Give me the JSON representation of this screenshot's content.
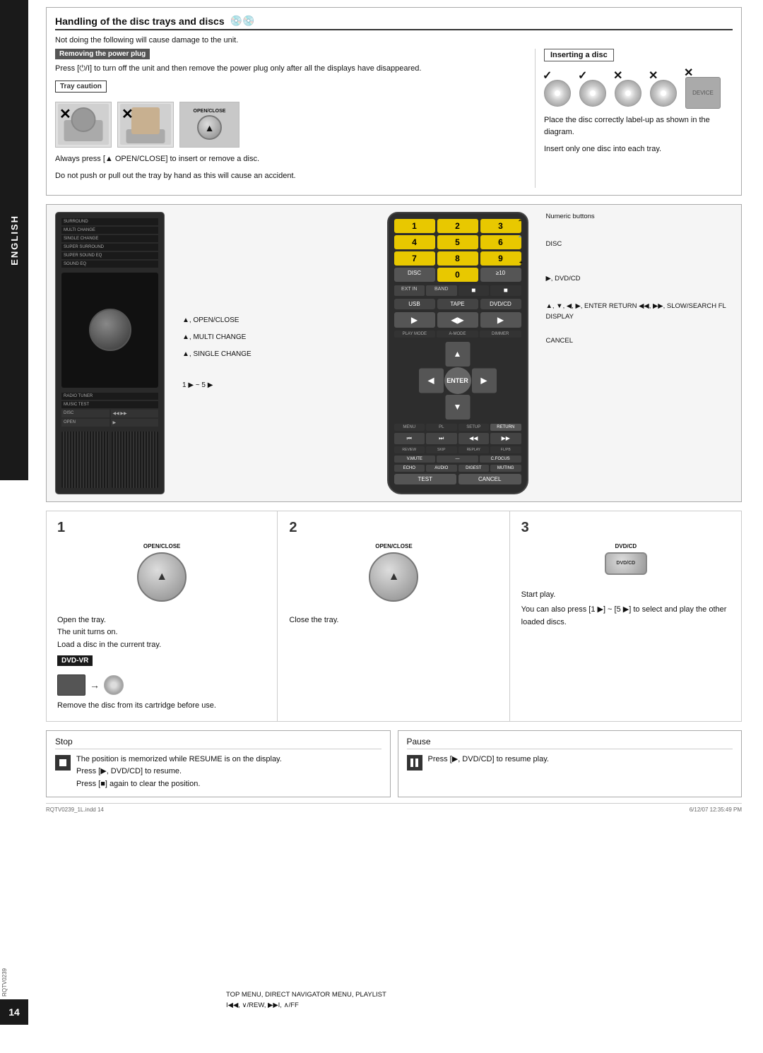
{
  "page": {
    "number": "14",
    "language_sidebar": "ENGLISH",
    "doc_id": "RQTV0239"
  },
  "handling_section": {
    "title": "Handling of the disc trays and discs",
    "warning_text": "Not doing the following will cause damage to the unit.",
    "removing_plug_label": "Removing the power plug",
    "press_text": "Press [⏻/I] to turn off the unit and then remove the power plug only after all the displays have disappeared.",
    "tray_caution_label": "Tray caution",
    "open_close_label": "OPEN/CLOSE",
    "always_press_text": "Always press [▲ OPEN/CLOSE] to insert or remove a disc.",
    "not_push_text": "Do not push or pull out the tray by hand as this will cause an accident.",
    "inserting_label": "Inserting a disc",
    "place_disc_text": "Place the disc correctly label-up as shown in the diagram.",
    "insert_one_text": "Insert only one disc into each tray."
  },
  "remote_section": {
    "stereo_labels": [
      "SURROUND",
      "MULTI CHANGE",
      "SINGLE CHANGE",
      "SUPER SURROUND",
      "SUPER SOUND EQ",
      "SOUND EQ",
      "RADIO TUNER",
      "MUSIC TEST",
      "DISC ▸",
      "OPEN ▸"
    ],
    "control_labels": [
      "▲, OPEN/CLOSE",
      "▲, MULTI CHANGE",
      "▲, SINGLE CHANGE",
      "1 ▶  ~  5 ▶"
    ],
    "numeric_label": "Numeric\nbuttons",
    "disc_label": "DISC",
    "dvd_cd_label": "▶, DVD/CD",
    "top_menu_labels": "TOP MENU,\nDIRECT NAVIGATOR\nMENU, PLAYLIST",
    "rew_ff_labels": "I◀◀, ∨/REW,\n▶▶I, ∧/FF",
    "nav_labels": "▲, ▼, ◀, ▶,\nENTER\nRETURN\n◀◀, ▶▶,\nSLOW/SEARCH\nFL DISPLAY",
    "cancel_label": "CANCEL",
    "remote_buttons": {
      "row1": [
        "1",
        "2",
        "3"
      ],
      "row2": [
        "4",
        "5",
        "6"
      ],
      "row3": [
        "7",
        "8",
        "9"
      ],
      "row4": [
        "DISC",
        "0",
        "≥10"
      ],
      "row5": [
        "USB",
        "TAPE",
        "DVD/CD"
      ]
    }
  },
  "steps": [
    {
      "number": "1",
      "button_label": "OPEN/CLOSE",
      "text1": "Open the tray.",
      "text2": "The unit turns on.",
      "text3": "Load a disc in the current tray.",
      "dvd_vr_label": "DVD-VR",
      "dvd_vr_text": "Remove the disc from its cartridge before use."
    },
    {
      "number": "2",
      "button_label": "OPEN/CLOSE",
      "text1": "Close the tray."
    },
    {
      "number": "3",
      "button_label": "DVD/CD",
      "text1": "Start play.",
      "text2": "You can also press [1 ▶] ~ [5 ▶] to select and play the other loaded discs."
    }
  ],
  "stop_section": {
    "title": "Stop",
    "text1": "The position is memorized while  RESUME  is on the display.",
    "text2": "Press [▶, DVD/CD] to resume.",
    "text3": "Press [■] again to clear the position."
  },
  "pause_section": {
    "title": "Pause",
    "text1": "Press [▶, DVD/CD] to resume play."
  },
  "footer": {
    "file_info": "RQTV0239_1L.indd  14",
    "date_info": "6/12/07  12:35:49 PM"
  }
}
